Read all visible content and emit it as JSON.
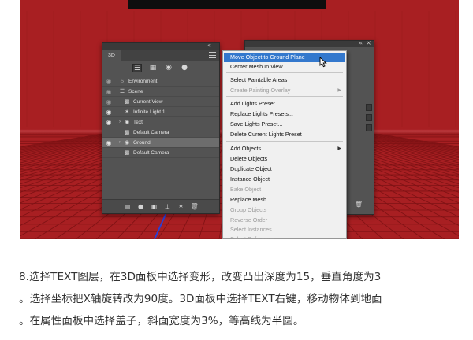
{
  "panel_3d": {
    "title": "3D",
    "toolbar_icons": [
      "scene-filter-icon",
      "mesh-filter-icon",
      "material-filter-icon",
      "light-filter-icon"
    ],
    "layers": [
      {
        "name": "Environment",
        "visible": "dim",
        "icon": "environment-icon"
      },
      {
        "name": "Scene",
        "visible": "dim",
        "icon": "scene-icon"
      },
      {
        "name": "Current View",
        "visible": "dim",
        "icon": "camera-icon"
      },
      {
        "name": "Infinite Light 1",
        "visible": "on",
        "icon": "infinite-light-icon"
      },
      {
        "name": "Text",
        "visible": "on",
        "icon": "mesh-icon",
        "expandable": true
      },
      {
        "name": "Default Camera",
        "visible": "none",
        "icon": "camera-icon"
      },
      {
        "name": "Ground",
        "visible": "on",
        "icon": "mesh-icon",
        "expandable": true,
        "selected": true
      },
      {
        "name": "Default Camera",
        "visible": "none",
        "icon": "camera-icon"
      }
    ],
    "bottom_icons": [
      "add-mesh-icon",
      "add-light-icon",
      "render-icon",
      "drop-to-ground-icon",
      "new-light-icon",
      "delete-icon"
    ]
  },
  "properties_panel": {
    "title": "Properties"
  },
  "context_menu": {
    "items": [
      {
        "label": "Move Object to Ground Plane",
        "state": "highlight"
      },
      {
        "label": "Center Mesh In View",
        "state": "normal"
      },
      {
        "label": "Select Paintable Areas",
        "state": "normal"
      },
      {
        "label": "Create Painting Overlay",
        "state": "disabled",
        "submenu": true
      },
      {
        "label": "Add Lights Preset...",
        "state": "normal"
      },
      {
        "label": "Replace Lights Presets...",
        "state": "normal"
      },
      {
        "label": "Save Lights Preset...",
        "state": "normal"
      },
      {
        "label": "Delete Current Lights Preset",
        "state": "normal"
      },
      {
        "label": "Add Objects",
        "state": "normal",
        "submenu": true
      },
      {
        "label": "Delete Objects",
        "state": "normal"
      },
      {
        "label": "Duplicate Object",
        "state": "normal"
      },
      {
        "label": "Instance Object",
        "state": "normal"
      },
      {
        "label": "Bake Object",
        "state": "disabled"
      },
      {
        "label": "Replace Mesh",
        "state": "normal"
      },
      {
        "label": "Group Objects",
        "state": "disabled"
      },
      {
        "label": "Reverse Order",
        "state": "disabled"
      },
      {
        "label": "Select Instances",
        "state": "disabled"
      },
      {
        "label": "Select Reference",
        "state": "disabled"
      }
    ]
  },
  "caption": {
    "line1": "8.选择TEXT图层，在3D面板中选择变形，改变凸出深度为15，垂直角度为3",
    "line2": "。选择坐标把X轴旋转改为90度。3D面板中选择TEXT右键，移动物体到地面",
    "line3": "。在属性面板中选择盖子，斜面宽度为3%，等高线为半圆。"
  },
  "colors": {
    "background_red": "#a81f22",
    "menu_highlight": "#3378cd",
    "panel_gray": "#535353"
  }
}
